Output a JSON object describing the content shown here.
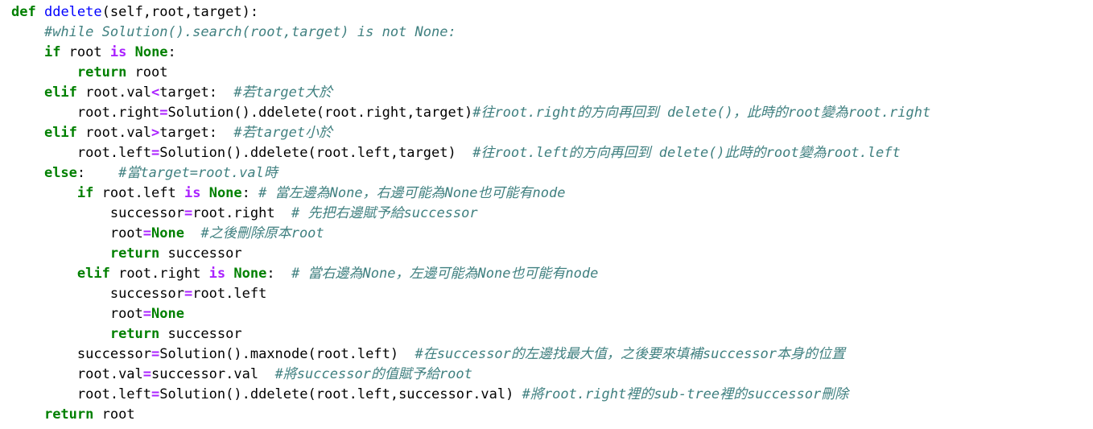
{
  "colors": {
    "background": "#ffffff",
    "keyword": "#008000",
    "function_name": "#0000ff",
    "operator": "#aa22ff",
    "comment": "#408080",
    "text": "#000000"
  },
  "code": {
    "lines": [
      {
        "indent": 0,
        "tokens": [
          {
            "t": "kw",
            "text": "def"
          },
          {
            "t": "plain",
            "text": " "
          },
          {
            "t": "fn",
            "text": "ddelete"
          },
          {
            "t": "plain",
            "text": "(self,root,target):"
          }
        ]
      },
      {
        "indent": 4,
        "tokens": [
          {
            "t": "comment",
            "text": "#while Solution().search(root,target) is not None:"
          }
        ]
      },
      {
        "indent": 4,
        "tokens": [
          {
            "t": "kw",
            "text": "if"
          },
          {
            "t": "plain",
            "text": " root "
          },
          {
            "t": "op",
            "text": "is"
          },
          {
            "t": "plain",
            "text": " "
          },
          {
            "t": "kw",
            "text": "None"
          },
          {
            "t": "plain",
            "text": ":"
          }
        ]
      },
      {
        "indent": 8,
        "tokens": [
          {
            "t": "kw",
            "text": "return"
          },
          {
            "t": "plain",
            "text": " root"
          }
        ]
      },
      {
        "indent": 4,
        "tokens": [
          {
            "t": "kw",
            "text": "elif"
          },
          {
            "t": "plain",
            "text": " root.val"
          },
          {
            "t": "op",
            "text": "<"
          },
          {
            "t": "plain",
            "text": "target:  "
          },
          {
            "t": "comment",
            "text": "#若target大於"
          }
        ]
      },
      {
        "indent": 8,
        "tokens": [
          {
            "t": "plain",
            "text": "root.right"
          },
          {
            "t": "op",
            "text": "="
          },
          {
            "t": "plain",
            "text": "Solution().ddelete(root.right,target)"
          },
          {
            "t": "comment",
            "text": "#往root.right的方向再回到 delete()，此時的root變為root.right"
          }
        ]
      },
      {
        "indent": 4,
        "tokens": [
          {
            "t": "kw",
            "text": "elif"
          },
          {
            "t": "plain",
            "text": " root.val"
          },
          {
            "t": "op",
            "text": ">"
          },
          {
            "t": "plain",
            "text": "target:  "
          },
          {
            "t": "comment",
            "text": "#若target小於"
          }
        ]
      },
      {
        "indent": 8,
        "tokens": [
          {
            "t": "plain",
            "text": "root.left"
          },
          {
            "t": "op",
            "text": "="
          },
          {
            "t": "plain",
            "text": "Solution().ddelete(root.left,target)  "
          },
          {
            "t": "comment",
            "text": "#往root.left的方向再回到 delete()此時的root變為root.left"
          }
        ]
      },
      {
        "indent": 4,
        "tokens": [
          {
            "t": "kw",
            "text": "else"
          },
          {
            "t": "plain",
            "text": ":    "
          },
          {
            "t": "comment",
            "text": "#當target=root.val時"
          }
        ]
      },
      {
        "indent": 8,
        "tokens": [
          {
            "t": "kw",
            "text": "if"
          },
          {
            "t": "plain",
            "text": " root.left "
          },
          {
            "t": "op",
            "text": "is"
          },
          {
            "t": "plain",
            "text": " "
          },
          {
            "t": "kw",
            "text": "None"
          },
          {
            "t": "plain",
            "text": ": "
          },
          {
            "t": "comment",
            "text": "# 當左邊為None，右邊可能為None也可能有node"
          }
        ]
      },
      {
        "indent": 12,
        "tokens": [
          {
            "t": "plain",
            "text": "successor"
          },
          {
            "t": "op",
            "text": "="
          },
          {
            "t": "plain",
            "text": "root.right  "
          },
          {
            "t": "comment",
            "text": "# 先把右邊賦予給successor"
          }
        ]
      },
      {
        "indent": 12,
        "tokens": [
          {
            "t": "plain",
            "text": "root"
          },
          {
            "t": "op",
            "text": "="
          },
          {
            "t": "kw",
            "text": "None"
          },
          {
            "t": "plain",
            "text": "  "
          },
          {
            "t": "comment",
            "text": "#之後刪除原本root"
          }
        ]
      },
      {
        "indent": 12,
        "tokens": [
          {
            "t": "kw",
            "text": "return"
          },
          {
            "t": "plain",
            "text": " successor"
          }
        ]
      },
      {
        "indent": 8,
        "tokens": [
          {
            "t": "kw",
            "text": "elif"
          },
          {
            "t": "plain",
            "text": " root.right "
          },
          {
            "t": "op",
            "text": "is"
          },
          {
            "t": "plain",
            "text": " "
          },
          {
            "t": "kw",
            "text": "None"
          },
          {
            "t": "plain",
            "text": ":  "
          },
          {
            "t": "comment",
            "text": "# 當右邊為None，左邊可能為None也可能有node"
          }
        ]
      },
      {
        "indent": 12,
        "tokens": [
          {
            "t": "plain",
            "text": "successor"
          },
          {
            "t": "op",
            "text": "="
          },
          {
            "t": "plain",
            "text": "root.left"
          }
        ]
      },
      {
        "indent": 12,
        "tokens": [
          {
            "t": "plain",
            "text": "root"
          },
          {
            "t": "op",
            "text": "="
          },
          {
            "t": "kw",
            "text": "None"
          }
        ]
      },
      {
        "indent": 12,
        "tokens": [
          {
            "t": "kw",
            "text": "return"
          },
          {
            "t": "plain",
            "text": " successor"
          }
        ]
      },
      {
        "indent": 8,
        "tokens": [
          {
            "t": "plain",
            "text": "successor"
          },
          {
            "t": "op",
            "text": "="
          },
          {
            "t": "plain",
            "text": "Solution().maxnode(root.left)  "
          },
          {
            "t": "comment",
            "text": "#在successor的左邊找最大值，之後要來填補successor本身的位置"
          }
        ]
      },
      {
        "indent": 8,
        "tokens": [
          {
            "t": "plain",
            "text": "root.val"
          },
          {
            "t": "op",
            "text": "="
          },
          {
            "t": "plain",
            "text": "successor.val  "
          },
          {
            "t": "comment",
            "text": "#將successor的值賦予給root"
          }
        ]
      },
      {
        "indent": 8,
        "tokens": [
          {
            "t": "plain",
            "text": "root.left"
          },
          {
            "t": "op",
            "text": "="
          },
          {
            "t": "plain",
            "text": "Solution().ddelete(root.left,successor.val) "
          },
          {
            "t": "comment",
            "text": "#將root.right裡的sub-tree裡的successor刪除"
          }
        ]
      },
      {
        "indent": 4,
        "tokens": [
          {
            "t": "kw",
            "text": "return"
          },
          {
            "t": "plain",
            "text": " root"
          }
        ]
      }
    ]
  }
}
